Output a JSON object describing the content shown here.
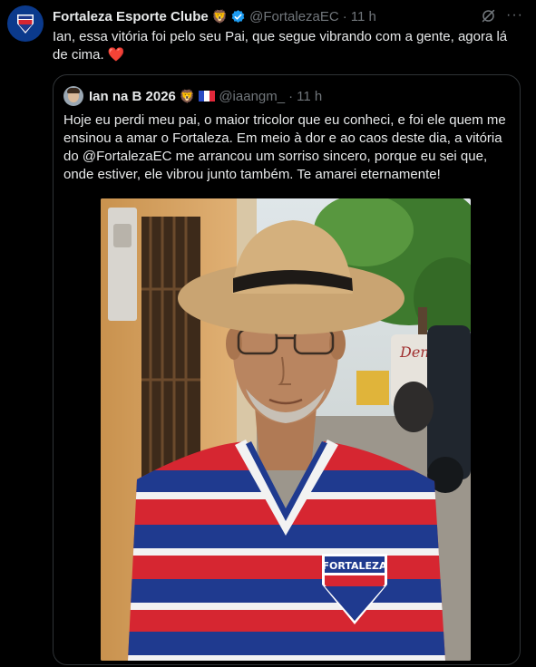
{
  "tweet": {
    "author_name": "Fortaleza Esporte Clube",
    "author_emoji": "🦁",
    "handle": "@FortalezaEC",
    "separator": "·",
    "time": "11 h",
    "text": "Ian, essa vitória foi pelo seu Pai, que segue vibrando com a gente, agora lá de cima.",
    "heart": "❤️",
    "more": "···"
  },
  "quote": {
    "author_name": "Ian na B 2026",
    "author_emoji": "🦁",
    "handle": "@iaangm_",
    "separator": "·",
    "time": "11 h",
    "text": "Hoje eu perdi meu pai, o maior tricolor que eu conheci, e foi ele quem me ensinou a amar o Fortaleza. Em meio à dor e ao caos deste dia, a vitória do @FortalezaEC me arrancou um sorriso sincero, porque eu sei que, onde estiver, ele vibrou junto também. Te amarei eternamente!",
    "photo_jersey_text": "FORTALEZA",
    "photo_sign_text": "Deni"
  },
  "colors": {
    "background": "#000000",
    "text": "#e7e9ea",
    "muted": "#71767b",
    "verified": "#1d9bf0",
    "jersey_red": "#d62631",
    "jersey_blue": "#1f3a8f"
  }
}
